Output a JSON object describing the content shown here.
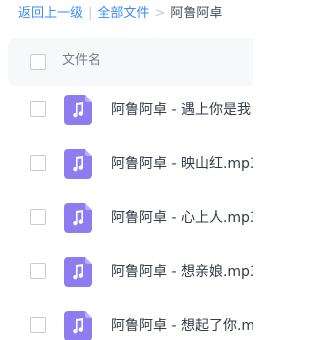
{
  "breadcrumb": {
    "back_label": "返回上一级",
    "separator_1": "|",
    "all_files_label": "全部文件",
    "separator_2": ">",
    "current_folder": "阿鲁阿卓"
  },
  "list_header": {
    "column_name": "文件名"
  },
  "files": [
    {
      "name": "阿鲁阿卓 - 遇上你是我",
      "icon": "music-file-icon"
    },
    {
      "name": "阿鲁阿卓 - 映山红.mp3",
      "icon": "music-file-icon"
    },
    {
      "name": "阿鲁阿卓 - 心上人.mp3",
      "icon": "music-file-icon"
    },
    {
      "name": "阿鲁阿卓 - 想亲娘.mp3",
      "icon": "music-file-icon"
    },
    {
      "name": "阿鲁阿卓 - 想起了你.m",
      "icon": "music-file-icon"
    }
  ],
  "colors": {
    "accent": "#3b8cf7",
    "music_icon": "#8f7cf1",
    "header_bg": "#f7f8fa"
  }
}
